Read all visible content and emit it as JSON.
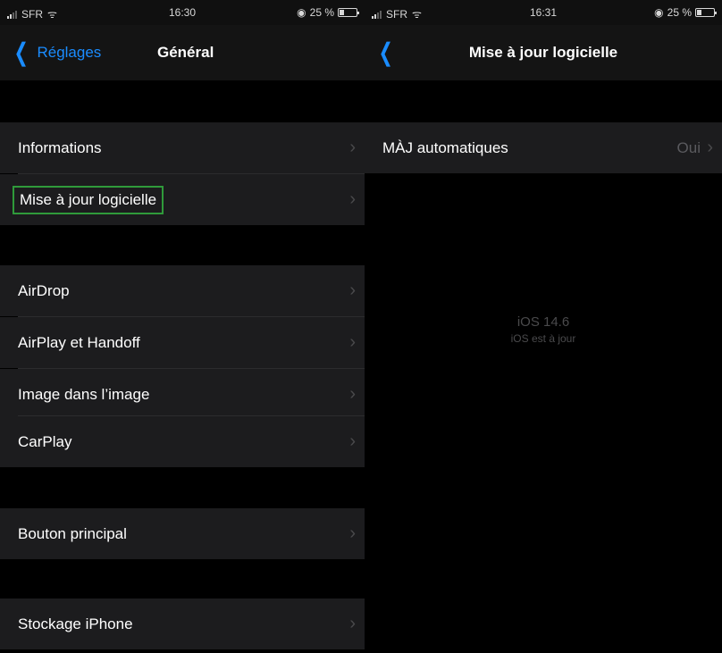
{
  "left_screen": {
    "status": {
      "carrier": "SFR",
      "time": "16:30",
      "battery": "25 %"
    },
    "nav": {
      "back_label": "Réglages",
      "title": "Général"
    },
    "items": [
      {
        "label": "Informations"
      },
      {
        "label": "Mise à jour logicielle"
      },
      {
        "label": "AirDrop"
      },
      {
        "label": "AirPlay et Handoff"
      },
      {
        "label": "Image dans l’image"
      },
      {
        "label": "CarPlay"
      },
      {
        "label": "Bouton principal"
      },
      {
        "label": "Stockage iPhone"
      }
    ]
  },
  "right_screen": {
    "status": {
      "carrier": "SFR",
      "time": "16:31",
      "battery": "25 %"
    },
    "nav": {
      "title": "Mise à jour logicielle"
    },
    "auto_updates": {
      "label": "MÀJ automatiques",
      "value": "Oui"
    },
    "info": {
      "version": "iOS 14.6",
      "message": "iOS est à jour"
    }
  },
  "colors": {
    "accent": "#1a8cff",
    "highlight_border": "#2f9a3a",
    "cell_bg": "#1c1c1e"
  }
}
